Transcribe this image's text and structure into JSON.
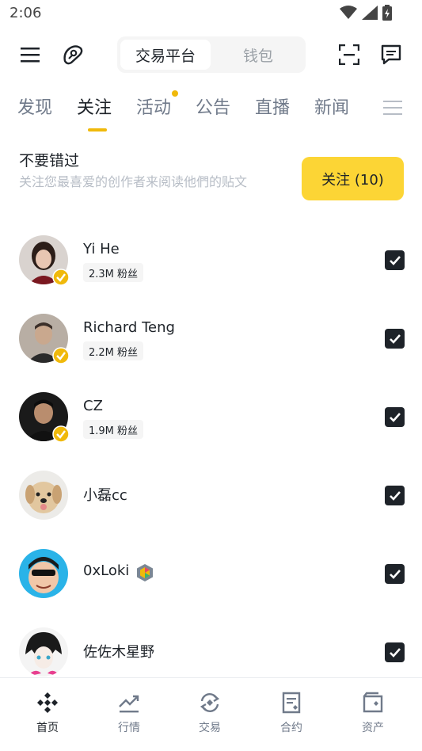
{
  "status_bar": {
    "time": "2:06"
  },
  "segment": {
    "active": "交易平台",
    "inactive": "钱包"
  },
  "tabs": [
    {
      "label": "发现"
    },
    {
      "label": "关注"
    },
    {
      "label": "活动"
    },
    {
      "label": "公告"
    },
    {
      "label": "直播"
    },
    {
      "label": "新闻"
    }
  ],
  "promo": {
    "title": "不要错过",
    "description": "关注您最喜爱的创作者来阅读他們的贴文",
    "button_label": "关注 (10)"
  },
  "creators": [
    {
      "name": "Yi He",
      "fans": "2.3M 粉丝",
      "verified": true,
      "checked": true
    },
    {
      "name": "Richard Teng",
      "fans": "2.2M 粉丝",
      "verified": true,
      "checked": true
    },
    {
      "name": "CZ",
      "fans": "1.9M 粉丝",
      "verified": true,
      "checked": true
    },
    {
      "name": "小磊cc",
      "fans": "",
      "verified": false,
      "checked": true
    },
    {
      "name": "0xLoki",
      "fans": "",
      "verified": false,
      "checked": true
    },
    {
      "name": "佐佐木星野",
      "fans": "",
      "verified": false,
      "checked": true
    }
  ],
  "bottom_nav": [
    {
      "label": "首页",
      "icon": "binance-home-icon",
      "active": true
    },
    {
      "label": "行情",
      "icon": "market-chart-icon",
      "active": false
    },
    {
      "label": "交易",
      "icon": "trade-icon",
      "active": false
    },
    {
      "label": "合约",
      "icon": "futures-icon",
      "active": false
    },
    {
      "label": "资产",
      "icon": "wallet-icon",
      "active": false
    }
  ],
  "colors": {
    "accent": "#fcd535",
    "text": "#1e2329",
    "muted": "#707a8a"
  }
}
